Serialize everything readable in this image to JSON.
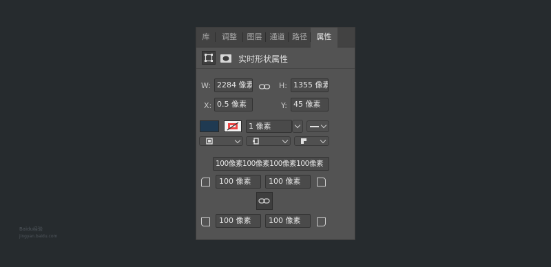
{
  "tabs": [
    "库",
    "调整",
    "图层",
    "通道",
    "路径",
    "属性"
  ],
  "panel_title": "实时形状属性",
  "size": {
    "w_label": "W:",
    "w_value": "2284 像素",
    "h_label": "H:",
    "h_value": "1355 像素"
  },
  "position": {
    "x_label": "X:",
    "x_value": "0.5 像素",
    "y_label": "Y:",
    "y_value": "45 像素"
  },
  "stroke": {
    "fill_color": "#1f3a52",
    "stroke_width": "1 像素"
  },
  "corners": {
    "combined": "100像素100像素100像素100像素",
    "top_left": "100 像素",
    "top_right": "100 像素",
    "bottom_left": "100 像素",
    "bottom_right": "100 像素"
  },
  "watermark": {
    "line1": "Baidu经验",
    "line2": "jingyan.baidu.com"
  }
}
